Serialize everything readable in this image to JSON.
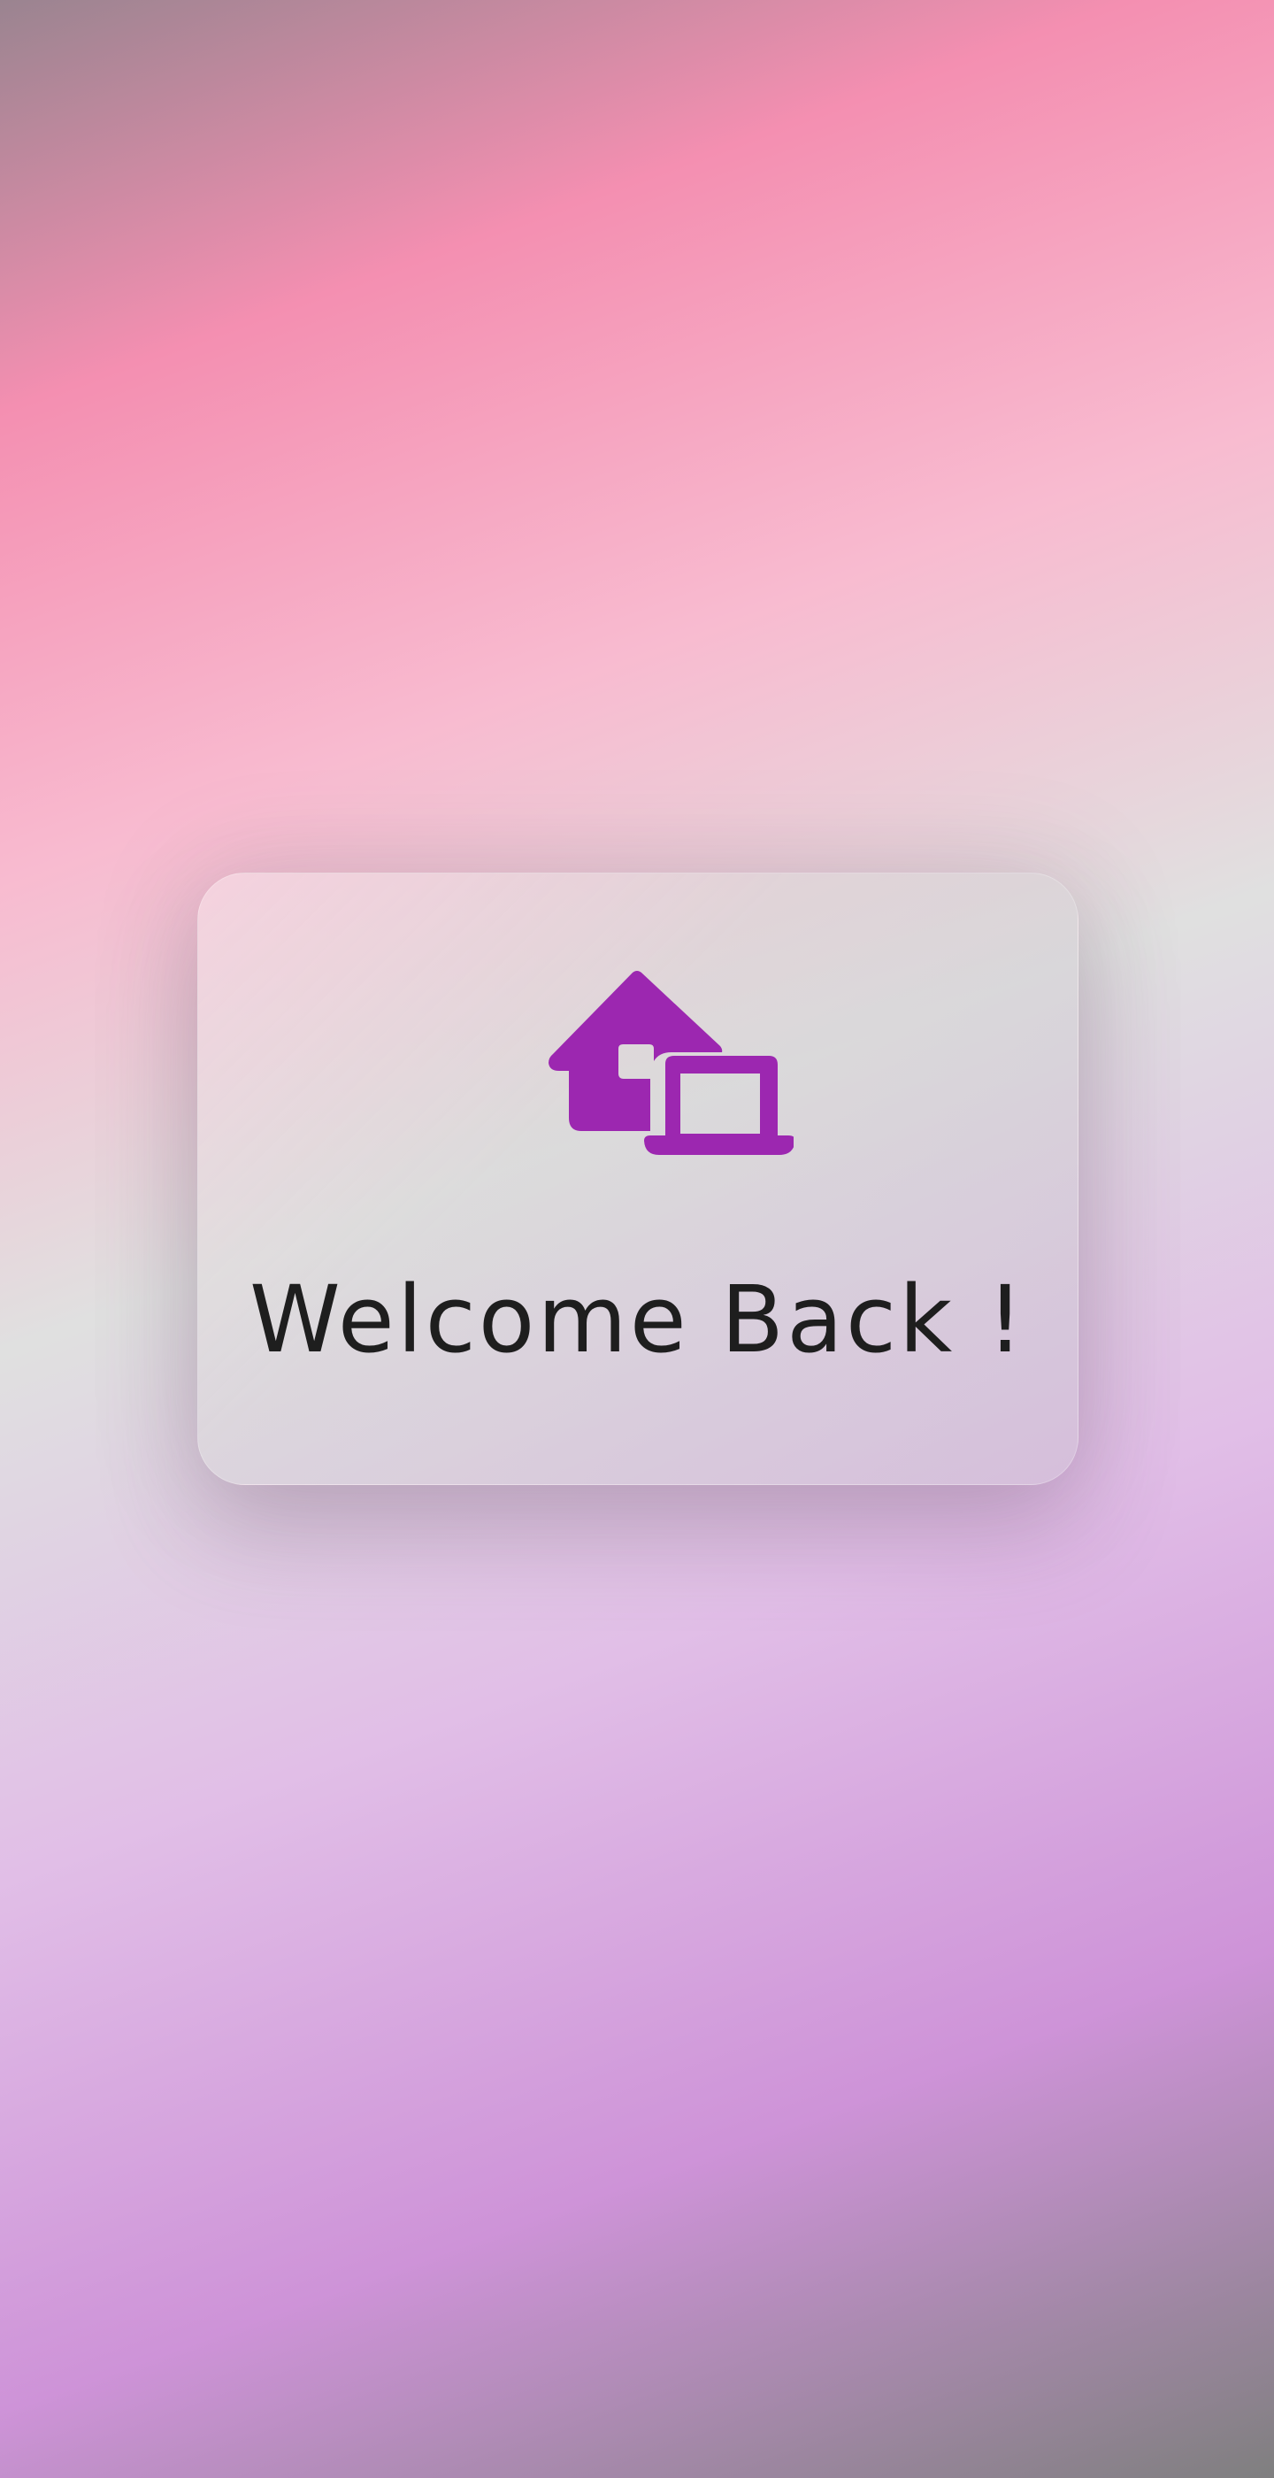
{
  "welcome_card": {
    "title": "Welcome Back !",
    "icon": "home-work-icon"
  },
  "colors": {
    "icon": "#9c27b0",
    "title_text": "#1e1e1e",
    "background_top": "#f48fb1",
    "background_middle": "#e0e0e0",
    "background_bottom": "#ce93d8"
  }
}
